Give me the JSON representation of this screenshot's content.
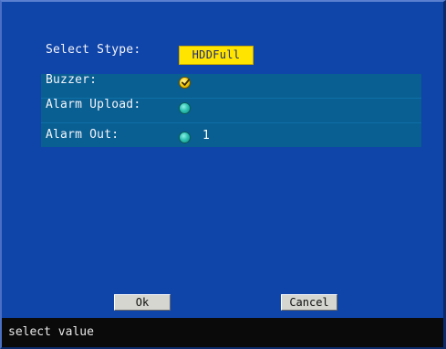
{
  "dialog": {
    "select_type_label": "Select Stype:",
    "select_type_value": "HDDFull",
    "rows": [
      {
        "label": "Buzzer:",
        "checked": true
      },
      {
        "label": "Alarm Upload:",
        "checked": false
      },
      {
        "label": "Alarm Out:",
        "checked": false,
        "value": "1"
      }
    ]
  },
  "buttons": {
    "ok_label": "Ok",
    "cancel_label": "Cancel"
  },
  "status": {
    "text": "select value"
  },
  "colors": {
    "background": "#0f44a8",
    "rows_panel": "#0a5f92",
    "selected_field": "#ffe400",
    "status_bar": "#0a0a0a"
  },
  "icons": {
    "checked": "checkmark-circle-icon",
    "unchecked": "radio-circle-icon"
  }
}
